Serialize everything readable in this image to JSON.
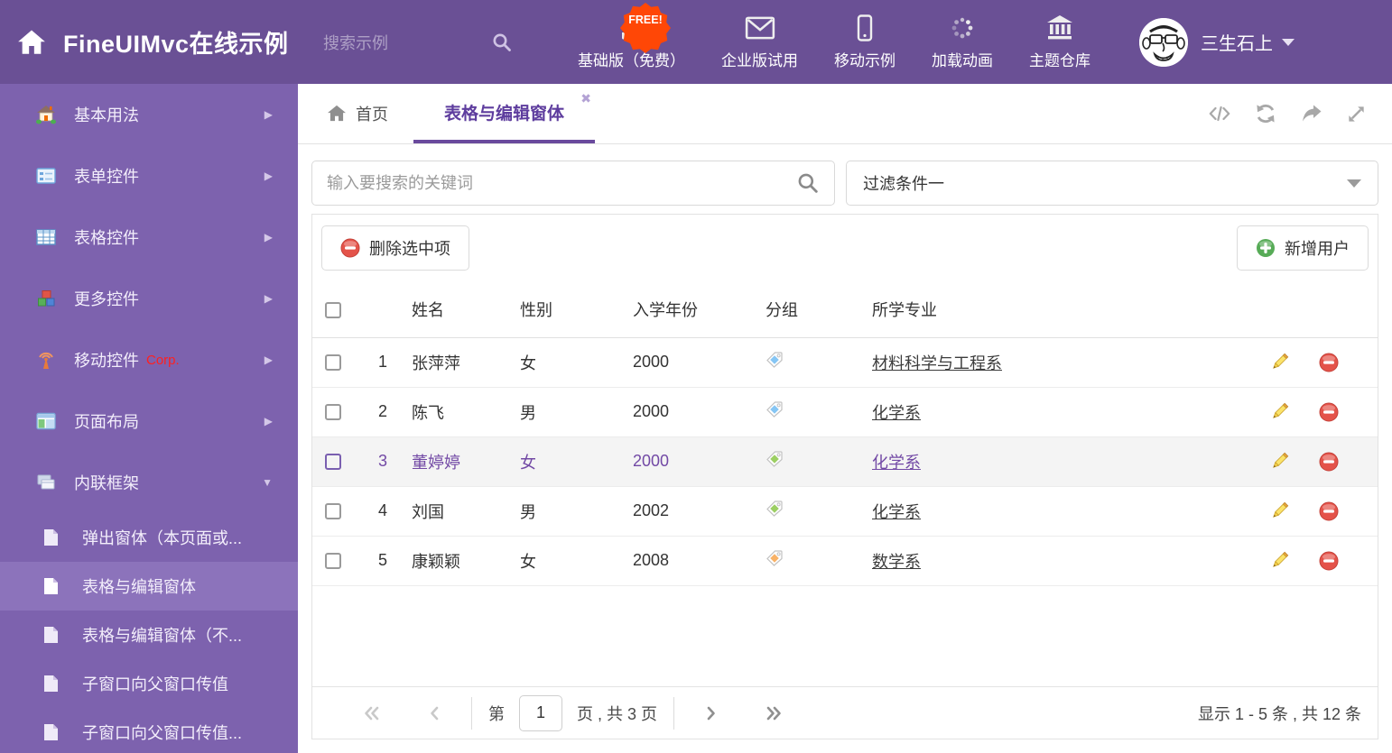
{
  "colors": {
    "header_bg": "#6a5095",
    "sidebar_bg": "#7d62ae",
    "accent_purple": "#6a4a9d",
    "free_badge_bg": "#ff4706",
    "delete_red": "#e4534a",
    "add_green": "#57ab57",
    "tag_blue": "#86c6f4",
    "tag_green": "#9ccf63",
    "tag_orange": "#f8b267"
  },
  "header": {
    "title": "FineUIMvc在线示例",
    "search_placeholder": "搜索示例",
    "free_badge": "FREE!",
    "nav": [
      {
        "label": "基础版（免费）",
        "icon": "download-icon"
      },
      {
        "label": "企业版试用",
        "icon": "envelope-icon"
      },
      {
        "label": "移动示例",
        "icon": "phone-icon"
      },
      {
        "label": "加载动画",
        "icon": "spinner-icon"
      },
      {
        "label": "主题仓库",
        "icon": "bank-icon"
      }
    ],
    "user_name": "三生石上"
  },
  "sidebar": {
    "items": [
      {
        "label": "基本用法"
      },
      {
        "label": "表单控件"
      },
      {
        "label": "表格控件"
      },
      {
        "label": "更多控件"
      },
      {
        "label": "移动控件",
        "badge": "Corp."
      },
      {
        "label": "页面布局"
      },
      {
        "label": "内联框架"
      }
    ],
    "subitems": [
      {
        "label": "弹出窗体（本页面或..."
      },
      {
        "label": "表格与编辑窗体"
      },
      {
        "label": "表格与编辑窗体（不..."
      },
      {
        "label": "子窗口向父窗口传值"
      },
      {
        "label": "子窗口向父窗口传值..."
      }
    ]
  },
  "tabs": {
    "home": "首页",
    "active": "表格与编辑窗体"
  },
  "filters": {
    "search_placeholder": "输入要搜索的关键词",
    "filter_value": "过滤条件一"
  },
  "toolbar": {
    "delete_label": "删除选中项",
    "add_label": "新增用户"
  },
  "table": {
    "headers": {
      "name": "姓名",
      "gender": "性别",
      "year": "入学年份",
      "group": "分组",
      "major": "所学专业"
    },
    "rows": [
      {
        "index": "1",
        "name": "张萍萍",
        "gender": "女",
        "year": "2000",
        "tag_color": "#86c6f4",
        "major": "材料科学与工程系"
      },
      {
        "index": "2",
        "name": "陈飞",
        "gender": "男",
        "year": "2000",
        "tag_color": "#86c6f4",
        "major": "化学系"
      },
      {
        "index": "3",
        "name": "董婷婷",
        "gender": "女",
        "year": "2000",
        "tag_color": "#9ccf63",
        "major": "化学系"
      },
      {
        "index": "4",
        "name": "刘国",
        "gender": "男",
        "year": "2002",
        "tag_color": "#9ccf63",
        "major": "化学系"
      },
      {
        "index": "5",
        "name": "康颖颖",
        "gender": "女",
        "year": "2008",
        "tag_color": "#f8b267",
        "major": "数学系"
      }
    ]
  },
  "pagination": {
    "prefix": "第",
    "page": "1",
    "suffix": "页 , 共 3 页",
    "summary": "显示 1 - 5 条 , 共 12 条"
  }
}
